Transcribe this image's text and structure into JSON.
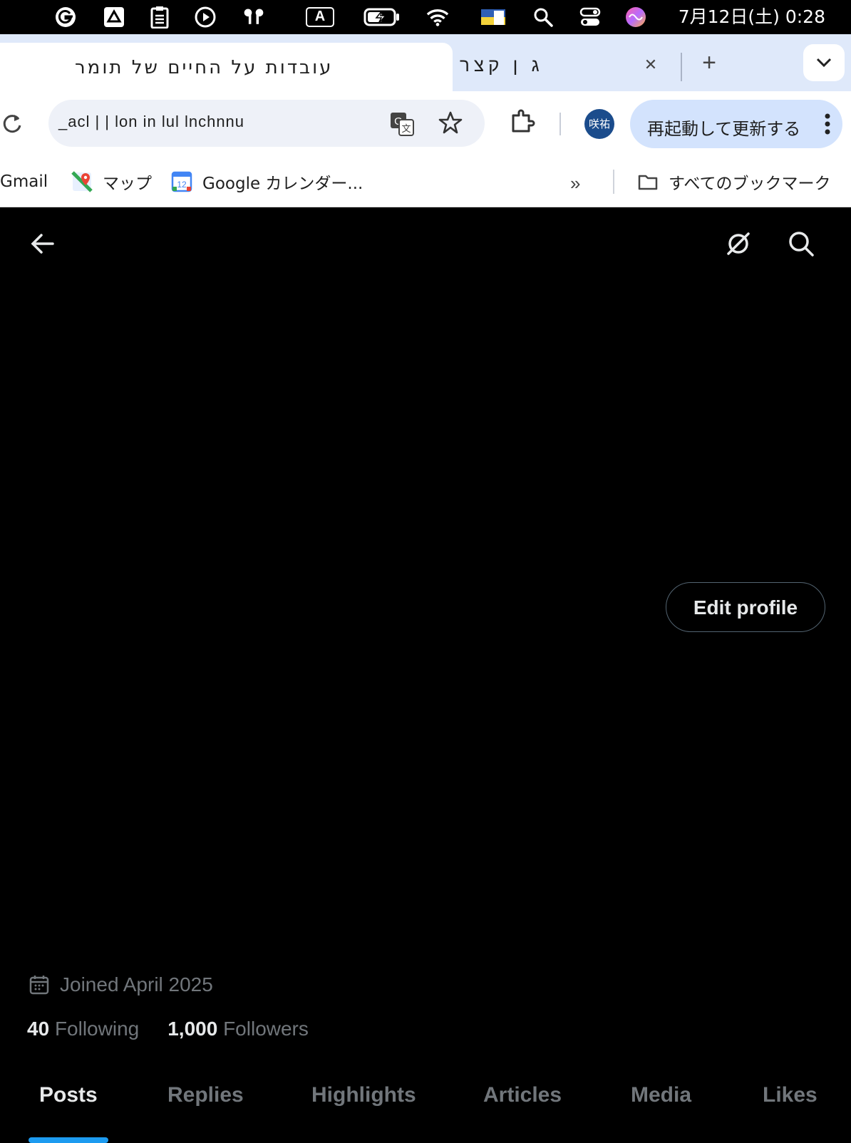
{
  "menubar": {
    "clock": "7月12日(土)  0:28",
    "input_mode_label": "A",
    "icons": [
      "grammarly-icon",
      "drive-icon",
      "clipboard-icon",
      "play-icon",
      "airpods-icon",
      "input-mode-icon",
      "battery-charging-icon",
      "wifi-icon",
      "flag-icon",
      "spotlight-search-icon",
      "control-center-icon",
      "siri-icon"
    ]
  },
  "browser": {
    "active_tab_title": "עובדות על החיים של תומר",
    "inactive_tab_title": "ג  ן  קצר",
    "url": "_acl  |  |  lon in lul  lnchnnu",
    "avatar_label": "咲祐",
    "update_button": "再起動して更新する"
  },
  "bookmarks": [
    {
      "label": "Gmail",
      "icon": ""
    },
    {
      "label": "マップ",
      "icon": "maps-icon"
    },
    {
      "label": "Google カレンダー...",
      "icon": "calendar-icon",
      "icon_text": "12"
    }
  ],
  "all_bookmarks": "すべてのブックマーク",
  "profile": {
    "edit_button": "Edit profile",
    "joined": "Joined April 2025",
    "following_count": "40",
    "following_label": "Following",
    "followers_count": "1,000",
    "followers_label": "Followers"
  },
  "tabs": [
    "Posts",
    "Replies",
    "Highlights",
    "Articles",
    "Media",
    "Likes"
  ],
  "colors": {
    "accent": "#1d9bf0",
    "muted_text": "#71767b",
    "primary_text": "#e7e9ea",
    "tabstrip": "#dfe9fa",
    "update_button_bg": "#d3e3fd"
  }
}
